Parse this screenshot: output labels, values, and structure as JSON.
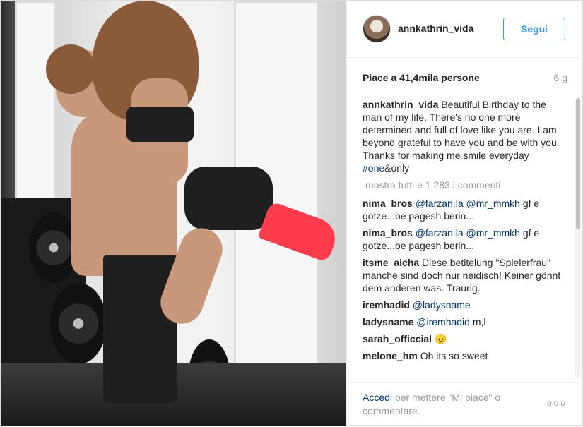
{
  "post": {
    "username": "annkathrin_vida",
    "follow_label": "Segui",
    "likes": "Piace a 41,4mila persone",
    "age": "6 g"
  },
  "caption": {
    "user": "annkathrin_vida",
    "text": " Beautiful Birthday to the man of my life. There's no one more determined and full of love like you are. I am beyond grateful to have you and be with you. Thanks for making me smile everyday ",
    "hashtag": "#one",
    "tail": "&only"
  },
  "view_all": "mostra tutti e 1.283 i commenti",
  "comments": [
    {
      "user": "nima_bros",
      "mention": "@farzan.la @mr_mmkh",
      "text": " gf e gotze...be pagesh berin..."
    },
    {
      "user": "nima_bros",
      "mention": "@farzan.la @mr_mmkh",
      "text": " gf e gotze...be pagesh berin..."
    },
    {
      "user": "itsme_aicha",
      "mention": "",
      "text": " Diese betitelung \"Spielerfrau\" manche sind doch nur neidisch! Keiner gönnt dem anderen was. Traurig."
    },
    {
      "user": "iremhadid",
      "mention": "@ladysname",
      "text": ""
    },
    {
      "user": "ladysname",
      "mention": "@iremhadid",
      "text": " m,l"
    },
    {
      "user": "sarah_officcial",
      "mention": "",
      "text": " 😠"
    },
    {
      "user": "melone_hm",
      "mention": "",
      "text": " Oh its so sweet"
    }
  ],
  "footer": {
    "login_link": "Accedi",
    "login_rest": " per mettere \"Mi piace\" o commentare.",
    "more_icon": "ellipsis-icon",
    "more_glyph": "ooo"
  }
}
